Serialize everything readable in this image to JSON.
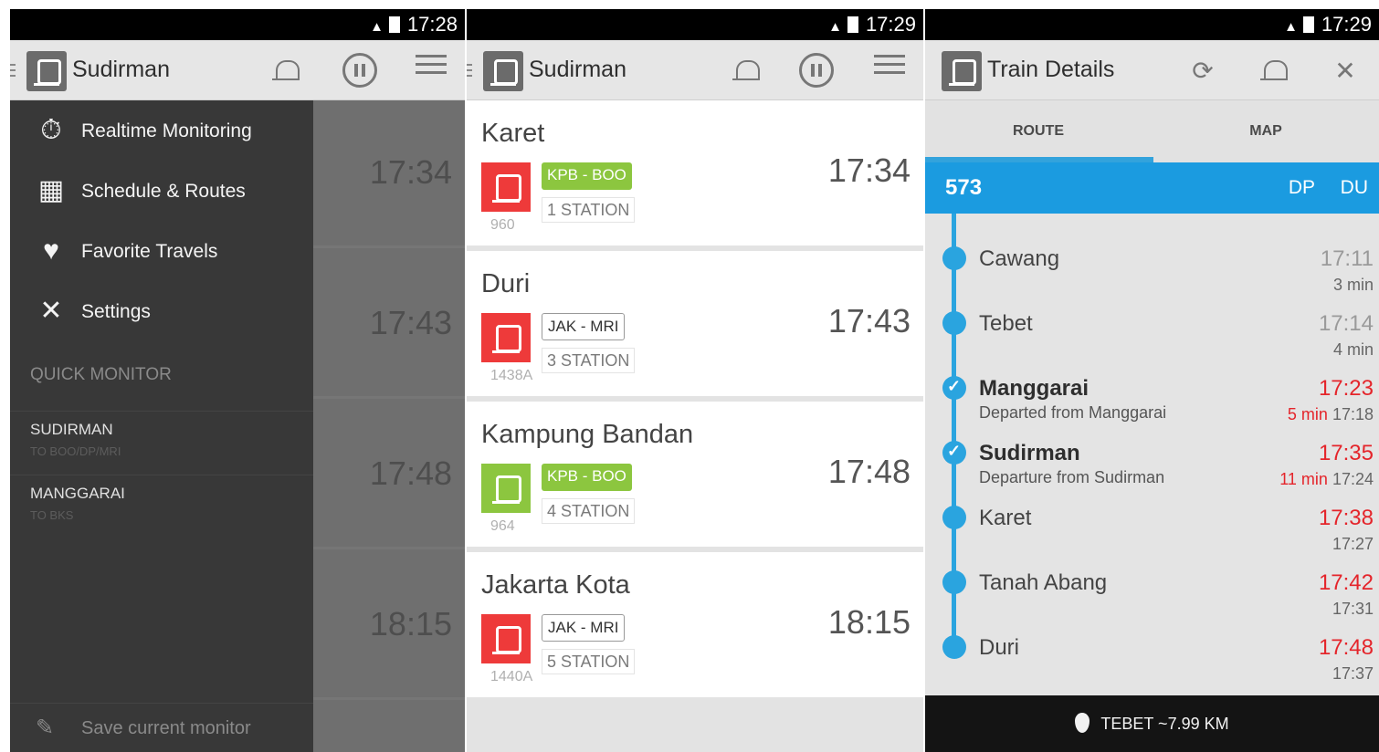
{
  "screens": [
    {
      "status_time": "17:28",
      "title": "Sudirman",
      "menu": [
        {
          "icon": "stopwatch-icon",
          "label": "Realtime Monitoring"
        },
        {
          "icon": "calendar-icon",
          "label": "Schedule & Routes"
        },
        {
          "icon": "heart-icon",
          "label": "Favorite Travels"
        },
        {
          "icon": "tools-icon",
          "label": "Settings"
        }
      ],
      "quick_monitor_header": "QUICK MONITOR",
      "quick_monitors": [
        {
          "name": "SUDIRMAN",
          "sub": "TO BOO/DP/MRI"
        },
        {
          "name": "MANGGARAI",
          "sub": "TO BKS"
        }
      ],
      "dimmed_times": [
        "17:34",
        "17:43",
        "17:48",
        "18:15"
      ],
      "save_label": "Save current monitor"
    },
    {
      "status_time": "17:29",
      "title": "Sudirman",
      "trains": [
        {
          "station": "Karet",
          "line": "KPB - BOO",
          "line_style": "green",
          "stations": "1 STATION",
          "number": "960",
          "time": "17:34",
          "tile_color": "#ee3a3a"
        },
        {
          "station": "Duri",
          "line": "JAK - MRI",
          "line_style": "white",
          "stations": "3 STATION",
          "number": "1438A",
          "time": "17:43",
          "tile_color": "#ee3a3a"
        },
        {
          "station": "Kampung Bandan",
          "line": "KPB - BOO",
          "line_style": "green",
          "stations": "4 STATION",
          "number": "964",
          "time": "17:48",
          "tile_color": "#8cc63f"
        },
        {
          "station": "Jakarta Kota",
          "line": "JAK - MRI",
          "line_style": "white",
          "stations": "5 STATION",
          "number": "1440A",
          "time": "18:15",
          "tile_color": "#ee3a3a"
        }
      ]
    },
    {
      "status_time": "17:29",
      "title": "Train Details",
      "tabs": [
        "ROUTE",
        "MAP"
      ],
      "train_no": "573",
      "tag1": "DP",
      "tag2": "DU",
      "stops": [
        {
          "name": "Cawang",
          "sub": "",
          "time": "17:11",
          "late": "",
          "sched": "3 min",
          "passed": false,
          "highlight": false
        },
        {
          "name": "Tebet",
          "sub": "",
          "time": "17:14",
          "late": "",
          "sched": "4 min",
          "passed": false,
          "highlight": false
        },
        {
          "name": "Manggarai",
          "sub": "Departed from Manggarai",
          "time": "17:23",
          "late": "5 min",
          "sched": "17:18",
          "passed": true,
          "highlight": true
        },
        {
          "name": "Sudirman",
          "sub": "Departure from Sudirman",
          "time": "17:35",
          "late": "11 min",
          "sched": "17:24",
          "passed": true,
          "highlight": true
        },
        {
          "name": "Karet",
          "sub": "",
          "time": "17:38",
          "late": "",
          "sched": "17:27",
          "passed": false,
          "highlight": false
        },
        {
          "name": "Tanah Abang",
          "sub": "",
          "time": "17:42",
          "late": "",
          "sched": "17:31",
          "passed": false,
          "highlight": false
        },
        {
          "name": "Duri",
          "sub": "",
          "time": "17:48",
          "late": "",
          "sched": "17:37",
          "passed": false,
          "highlight": false
        }
      ],
      "footer": "TEBET ~7.99 KM"
    }
  ],
  "colors": {
    "accent_blue": "#1b9be0",
    "late_red": "#e4252b",
    "line_green": "#8cc63f",
    "train_red": "#ee3a3a"
  }
}
